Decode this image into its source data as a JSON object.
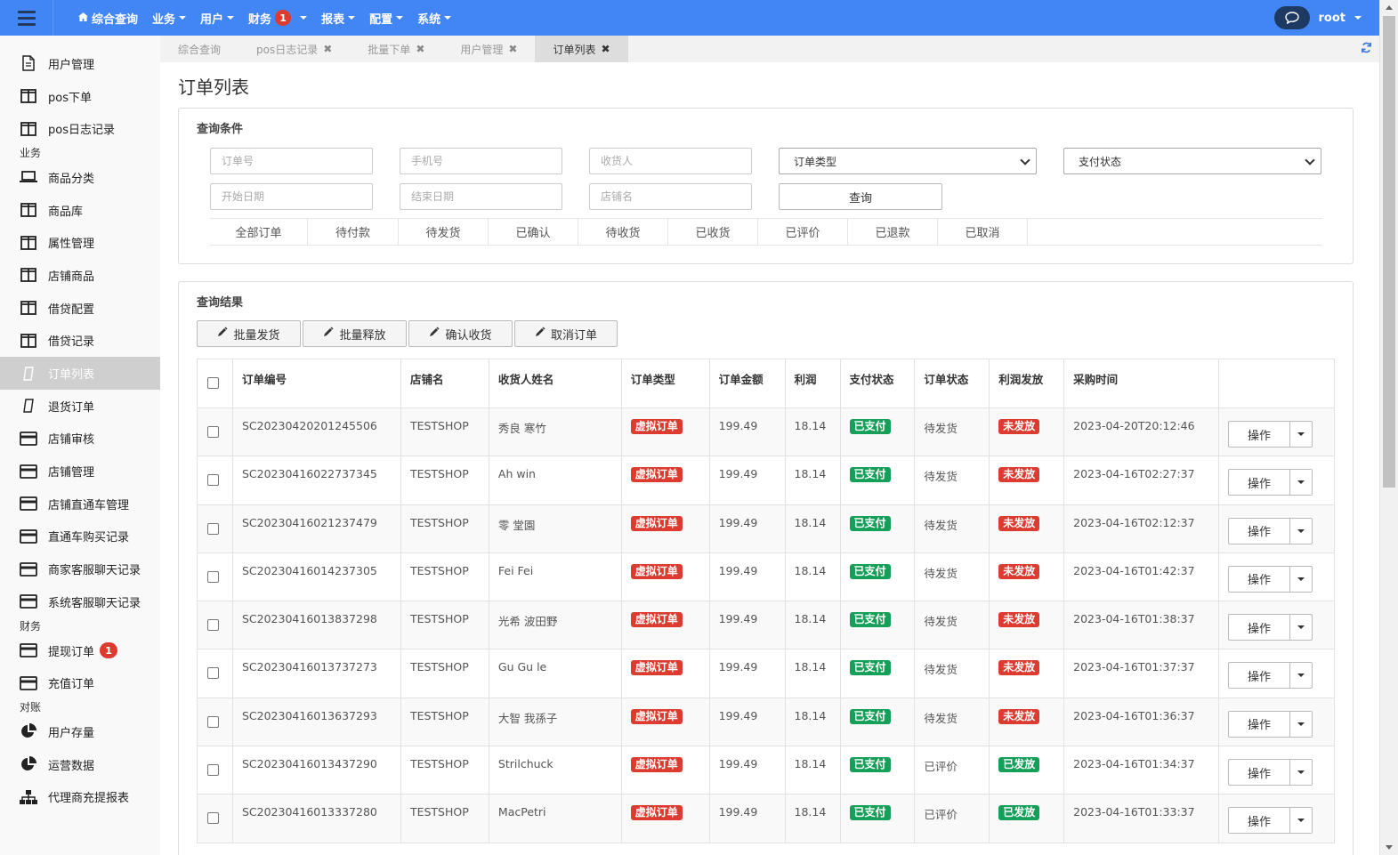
{
  "topbar": {
    "nav": [
      {
        "label": "综合查询",
        "home": true,
        "caret": false
      },
      {
        "label": "业务",
        "caret": true
      },
      {
        "label": "用户",
        "caret": true
      },
      {
        "label": "财务",
        "badge": "1",
        "caret": true
      },
      {
        "label": "报表",
        "caret": true
      },
      {
        "label": "配置",
        "caret": true
      },
      {
        "label": "系统",
        "caret": true
      }
    ],
    "user": "root"
  },
  "sidebar": [
    {
      "type": "item",
      "label": "用户管理",
      "icon": "document-icon"
    },
    {
      "type": "item",
      "label": "pos下单",
      "icon": "columns-icon"
    },
    {
      "type": "item",
      "label": "pos日志记录",
      "icon": "columns-icon"
    },
    {
      "type": "group",
      "label": "业务"
    },
    {
      "type": "item",
      "label": "商品分类",
      "icon": "laptop-icon"
    },
    {
      "type": "item",
      "label": "商品库",
      "icon": "columns-icon"
    },
    {
      "type": "item",
      "label": "属性管理",
      "icon": "columns-icon"
    },
    {
      "type": "item",
      "label": "店铺商品",
      "icon": "columns-icon"
    },
    {
      "type": "item",
      "label": "借贷配置",
      "icon": "columns-icon"
    },
    {
      "type": "item",
      "label": "借贷记录",
      "icon": "columns-icon"
    },
    {
      "type": "item",
      "label": "订单列表",
      "icon": "tablet-icon",
      "active": true
    },
    {
      "type": "item",
      "label": "退货订单",
      "icon": "tablet-icon"
    },
    {
      "type": "item",
      "label": "店铺审核",
      "icon": "credit-card-icon"
    },
    {
      "type": "item",
      "label": "店铺管理",
      "icon": "credit-card-icon"
    },
    {
      "type": "item",
      "label": "店铺直通车管理",
      "icon": "credit-card-icon"
    },
    {
      "type": "item",
      "label": "直通车购买记录",
      "icon": "credit-card-icon"
    },
    {
      "type": "item",
      "label": "商家客服聊天记录",
      "icon": "credit-card-icon"
    },
    {
      "type": "item",
      "label": "系统客服聊天记录",
      "icon": "credit-card-icon"
    },
    {
      "type": "group",
      "label": "财务"
    },
    {
      "type": "item",
      "label": "提现订单",
      "icon": "credit-card-icon",
      "badge": "1"
    },
    {
      "type": "item",
      "label": "充值订单",
      "icon": "credit-card-icon"
    },
    {
      "type": "group",
      "label": "对账"
    },
    {
      "type": "item",
      "label": "用户存量",
      "icon": "pie-chart-icon"
    },
    {
      "type": "item",
      "label": "运营数据",
      "icon": "pie-chart-icon"
    },
    {
      "type": "item",
      "label": "代理商充提报表",
      "icon": "sitemap-icon"
    }
  ],
  "tabs": [
    {
      "label": "综合查询",
      "closable": false
    },
    {
      "label": "pos日志记录",
      "closable": true
    },
    {
      "label": "批量下单",
      "closable": true
    },
    {
      "label": "用户管理",
      "closable": true
    },
    {
      "label": "订单列表",
      "closable": true,
      "active": true
    }
  ],
  "page": {
    "title": "订单列表",
    "query_panel": {
      "title": "查询条件",
      "order_no_placeholder": "订单号",
      "phone_placeholder": "手机号",
      "receiver_placeholder": "收货人",
      "order_type_select": "订单类型",
      "pay_status_select": "支付状态",
      "start_date_placeholder": "开始日期",
      "end_date_placeholder": "结束日期",
      "shop_name_placeholder": "店铺名",
      "query_button": "查询",
      "status_tabs": [
        "全部订单",
        "待付款",
        "待发货",
        "已确认",
        "待收货",
        "已收货",
        "已评价",
        "已退款",
        "已取消"
      ]
    },
    "result_panel": {
      "title": "查询结果",
      "buttons": [
        "批量发货",
        "批量释放",
        "确认收货",
        "取消订单"
      ]
    },
    "table": {
      "headers": [
        "订单编号",
        "店铺名",
        "收货人姓名",
        "订单类型",
        "订单金额",
        "利润",
        "支付状态",
        "订单状态",
        "利润发放",
        "采购时间"
      ],
      "action_label": "操作",
      "rows": [
        {
          "order_no": "SC20230420201245506",
          "shop": "TESTSHOP",
          "receiver": "秀良 寒竹",
          "type": "虚拟订单",
          "amount": "199.49",
          "profit": "18.14",
          "pay": "已支付",
          "status": "待发货",
          "payout": "未发放",
          "time": "2023-04-20T20:12:46"
        },
        {
          "order_no": "SC20230416022737345",
          "shop": "TESTSHOP",
          "receiver": "Ah win",
          "type": "虚拟订单",
          "amount": "199.49",
          "profit": "18.14",
          "pay": "已支付",
          "status": "待发货",
          "payout": "未发放",
          "time": "2023-04-16T02:27:37"
        },
        {
          "order_no": "SC20230416021237479",
          "shop": "TESTSHOP",
          "receiver": "零 堂園",
          "type": "虚拟订单",
          "amount": "199.49",
          "profit": "18.14",
          "pay": "已支付",
          "status": "待发货",
          "payout": "未发放",
          "time": "2023-04-16T02:12:37"
        },
        {
          "order_no": "SC20230416014237305",
          "shop": "TESTSHOP",
          "receiver": "Fei Fei",
          "type": "虚拟订单",
          "amount": "199.49",
          "profit": "18.14",
          "pay": "已支付",
          "status": "待发货",
          "payout": "未发放",
          "time": "2023-04-16T01:42:37"
        },
        {
          "order_no": "SC20230416013837298",
          "shop": "TESTSHOP",
          "receiver": "光希 波田野",
          "type": "虚拟订单",
          "amount": "199.49",
          "profit": "18.14",
          "pay": "已支付",
          "status": "待发货",
          "payout": "未发放",
          "time": "2023-04-16T01:38:37"
        },
        {
          "order_no": "SC20230416013737273",
          "shop": "TESTSHOP",
          "receiver": "Gu Gu le",
          "type": "虚拟订单",
          "amount": "199.49",
          "profit": "18.14",
          "pay": "已支付",
          "status": "待发货",
          "payout": "未发放",
          "time": "2023-04-16T01:37:37"
        },
        {
          "order_no": "SC20230416013637293",
          "shop": "TESTSHOP",
          "receiver": "大智 我孫子",
          "type": "虚拟订单",
          "amount": "199.49",
          "profit": "18.14",
          "pay": "已支付",
          "status": "待发货",
          "payout": "未发放",
          "time": "2023-04-16T01:36:37"
        },
        {
          "order_no": "SC20230416013437290",
          "shop": "TESTSHOP",
          "receiver": "Strilchuck",
          "type": "虚拟订单",
          "amount": "199.49",
          "profit": "18.14",
          "pay": "已支付",
          "status": "已评价",
          "payout": "已发放",
          "time": "2023-04-16T01:34:37"
        },
        {
          "order_no": "SC20230416013337280",
          "shop": "TESTSHOP",
          "receiver": "MacPetri",
          "type": "虚拟订单",
          "amount": "199.49",
          "profit": "18.14",
          "pay": "已支付",
          "status": "已评价",
          "payout": "已发放",
          "time": "2023-04-16T01:33:37"
        }
      ]
    }
  },
  "colors": {
    "topbar": "#4285f4",
    "badge_red": "#dd3b2f",
    "label_green": "#15a05a",
    "sidebar_active": "#cfcfcf"
  }
}
